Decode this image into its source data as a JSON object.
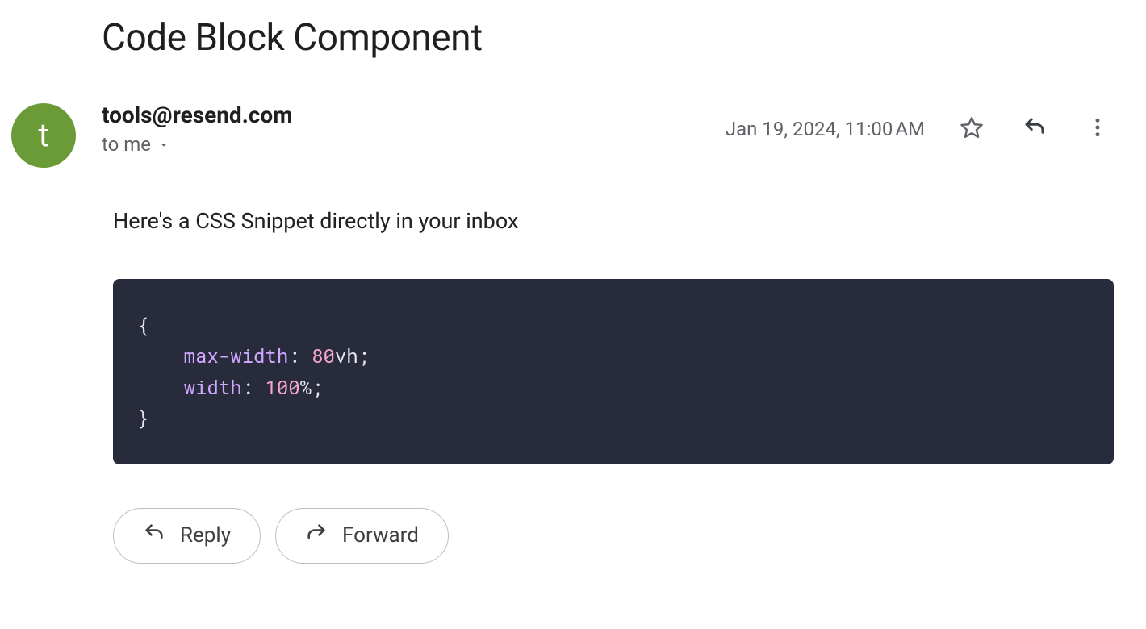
{
  "email": {
    "subject": "Code Block Component",
    "avatar_initial": "t",
    "sender": "tools@resend.com",
    "recipient_label": "to me",
    "date": "Jan 19, 2024, 11:00 AM",
    "intro": "Here's a CSS Snippet directly in your inbox"
  },
  "code": {
    "lang": "css",
    "lines": [
      {
        "tokens": [
          {
            "type": "punct",
            "text": "{"
          }
        ]
      },
      {
        "tokens": [
          {
            "type": "indent",
            "text": "    "
          },
          {
            "type": "prop",
            "text": "max-width"
          },
          {
            "type": "punct",
            "text": ": "
          },
          {
            "type": "num",
            "text": "80"
          },
          {
            "type": "unit",
            "text": "vh"
          },
          {
            "type": "punct",
            "text": ";"
          }
        ]
      },
      {
        "tokens": [
          {
            "type": "indent",
            "text": "    "
          },
          {
            "type": "prop",
            "text": "width"
          },
          {
            "type": "punct",
            "text": ": "
          },
          {
            "type": "num",
            "text": "100"
          },
          {
            "type": "unit",
            "text": "%"
          },
          {
            "type": "punct",
            "text": ";"
          }
        ]
      },
      {
        "tokens": [
          {
            "type": "punct",
            "text": "}"
          }
        ]
      }
    ]
  },
  "actions": {
    "reply_label": "Reply",
    "forward_label": "Forward"
  },
  "colors": {
    "avatar_bg": "#6b9b37",
    "code_bg": "#282B3B",
    "prop": "#d1a8ff",
    "num": "#f5a5c8",
    "default": "#e5e7eb"
  }
}
